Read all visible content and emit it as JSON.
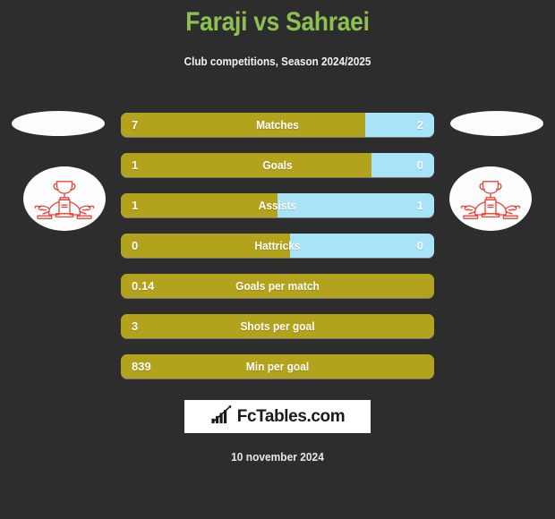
{
  "header": {
    "title": "Faraji vs Sahraei",
    "subtitle": "Club competitions, Season 2024/2025",
    "title_color": "#8cc152"
  },
  "crests": {
    "left_icon": "club-crest-icon",
    "right_icon": "club-crest-icon",
    "left_blank_icon": "blank-logo-placeholder-icon",
    "right_blank_icon": "blank-logo-placeholder-icon",
    "crest_color": "#e8453c"
  },
  "colors": {
    "home": "#b3a21b",
    "away": "#a8e4f7",
    "background": "#2d2d2d"
  },
  "footer": {
    "logo_text": "FcTables.com",
    "logo_icon": "bar-chart-trend-icon",
    "date": "10 november 2024"
  },
  "chart_data": {
    "type": "bar",
    "title": "Faraji vs Sahraei",
    "subtitle": "Club competitions, Season 2024/2025",
    "orientation": "horizontal-diverging",
    "series": [
      {
        "name": "Faraji",
        "color": "#b3a21b",
        "values": [
          7,
          1,
          1,
          0,
          0.14,
          3,
          839
        ]
      },
      {
        "name": "Sahraei",
        "color": "#a8e4f7",
        "values": [
          2,
          0,
          1,
          0,
          null,
          null,
          null
        ]
      }
    ],
    "categories": [
      "Matches",
      "Goals",
      "Assists",
      "Hattricks",
      "Goals per match",
      "Shots per goal",
      "Min per goal"
    ],
    "rows": [
      {
        "label": "Matches",
        "left": "7",
        "right": "2",
        "left_pct": 78,
        "single": false
      },
      {
        "label": "Goals",
        "left": "1",
        "right": "0",
        "left_pct": 80,
        "single": false
      },
      {
        "label": "Assists",
        "left": "1",
        "right": "1",
        "left_pct": 50,
        "single": false
      },
      {
        "label": "Hattricks",
        "left": "0",
        "right": "0",
        "left_pct": 54,
        "single": false
      },
      {
        "label": "Goals per match",
        "left": "0.14",
        "right": "",
        "left_pct": 100,
        "single": true
      },
      {
        "label": "Shots per goal",
        "left": "3",
        "right": "",
        "left_pct": 100,
        "single": true
      },
      {
        "label": "Min per goal",
        "left": "839",
        "right": "",
        "left_pct": 100,
        "single": true
      }
    ],
    "xlabel": "",
    "ylabel": "",
    "grid": false,
    "legend": "none"
  }
}
